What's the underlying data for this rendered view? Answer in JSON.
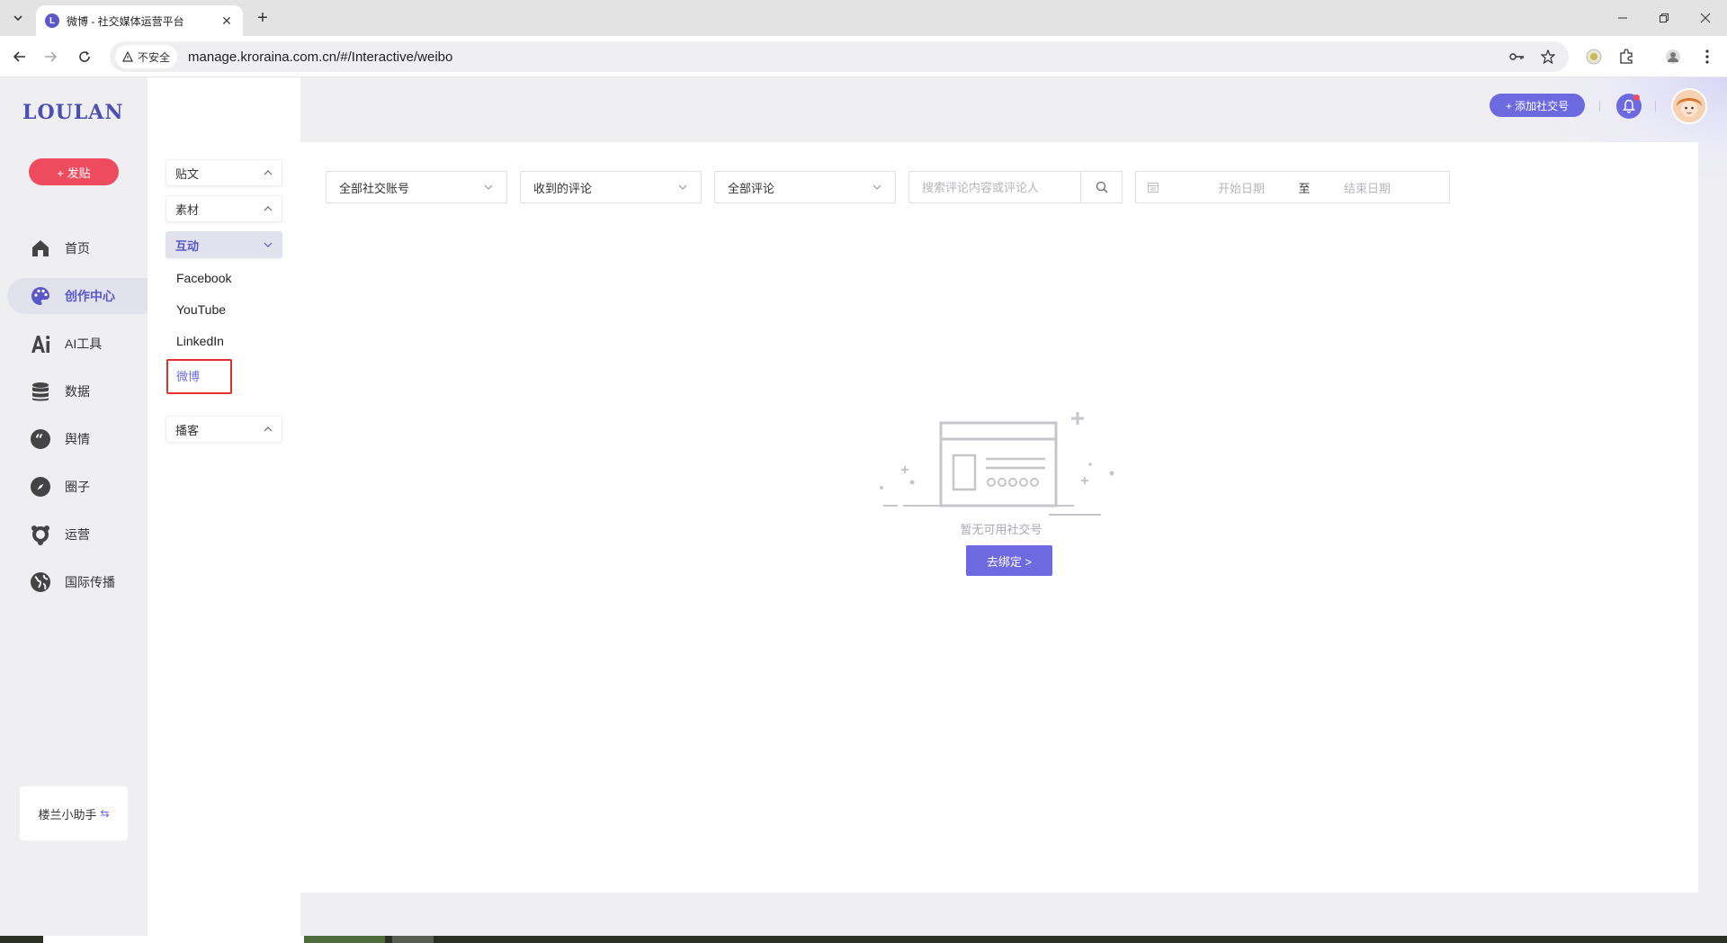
{
  "browser": {
    "tab_title": "微博 - 社交媒体运营平台",
    "security_label": "不安全",
    "url": "manage.kroraina.com.cn/#/Interactive/weibo"
  },
  "app": {
    "logo": "LOULAN",
    "post_button": "+ 发贴",
    "nav": [
      {
        "label": "首页",
        "icon": "home-icon"
      },
      {
        "label": "创作中心",
        "icon": "palette-icon"
      },
      {
        "label": "AI工具",
        "icon": "ai-icon"
      },
      {
        "label": "数据",
        "icon": "database-icon"
      },
      {
        "label": "舆情",
        "icon": "quote-icon"
      },
      {
        "label": "圈子",
        "icon": "compass-icon"
      },
      {
        "label": "运营",
        "icon": "operations-icon"
      },
      {
        "label": "国际传播",
        "icon": "globe-icon"
      }
    ],
    "helper_label": "楼兰小助手",
    "sub_nav": {
      "groups": [
        "贴文",
        "素材",
        "互动",
        "播客"
      ],
      "items": [
        "Facebook",
        "YouTube",
        "LinkedIn",
        "微博"
      ]
    },
    "header": {
      "add_account": "+ 添加社交号"
    },
    "filters": {
      "account_select": "全部社交账号",
      "type_select": "收到的评论",
      "comment_select": "全部评论",
      "search_placeholder": "搜索评论内容或评论人",
      "start_date_placeholder": "开始日期",
      "date_separator": "至",
      "end_date_placeholder": "结束日期"
    },
    "empty_state": {
      "message": "暂无可用社交号",
      "button": "去绑定 >"
    }
  },
  "colors": {
    "accent": "#6d6ae0",
    "post_button": "#ee4b5e",
    "highlight_box": "#e03030"
  }
}
